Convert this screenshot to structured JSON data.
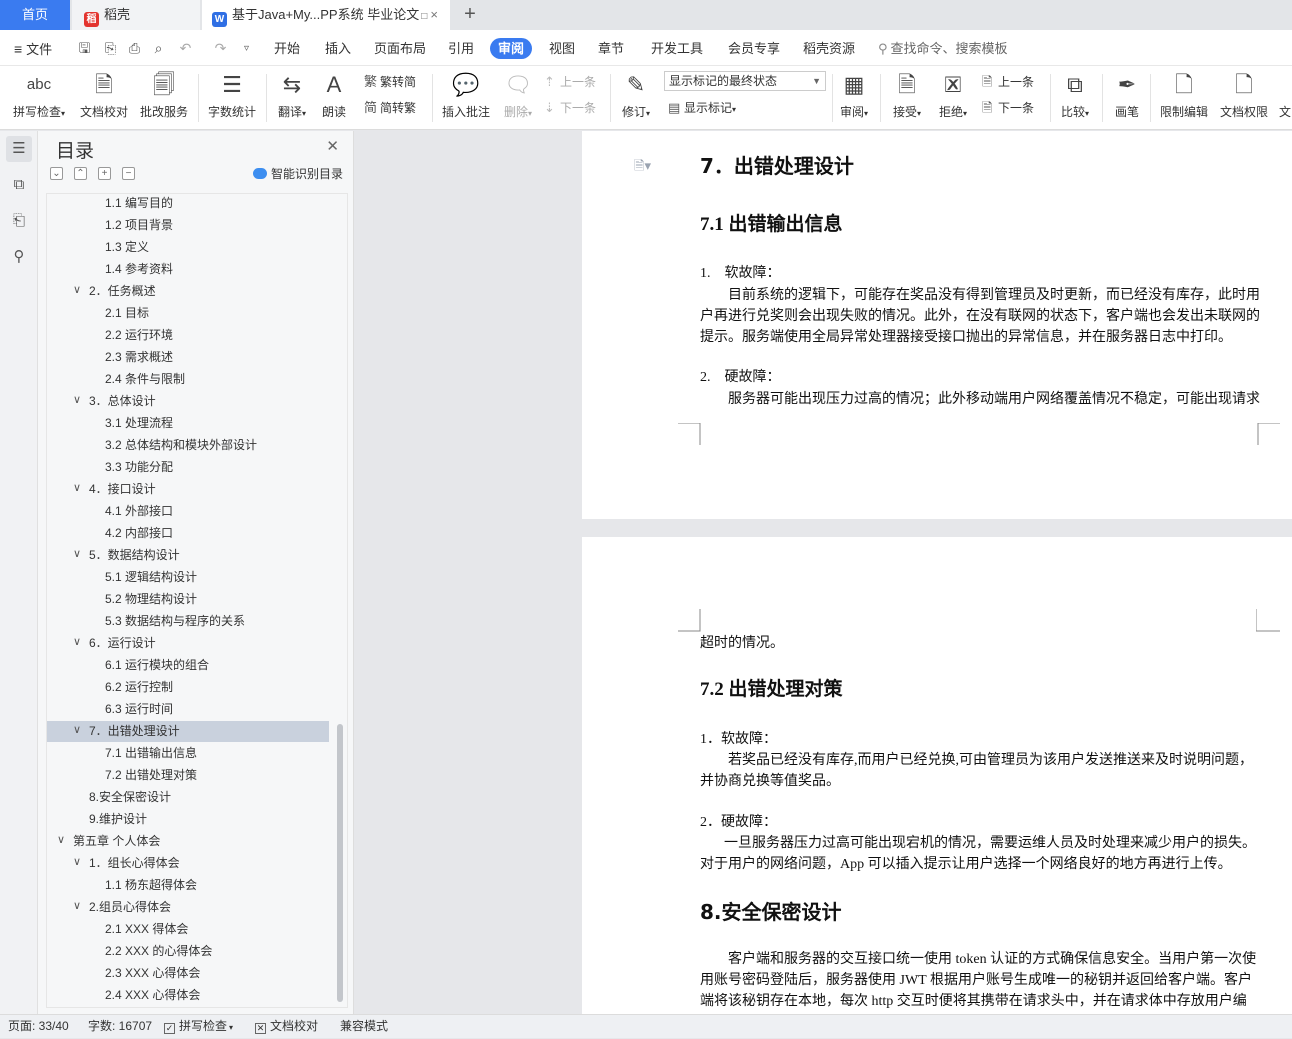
{
  "tabs": {
    "home": "首页",
    "daoke": "稻壳",
    "doc": "基于Java+My...PP系统 毕业论文",
    "doc_monitor_icon": "□",
    "close": "×",
    "add": "+"
  },
  "menu": {
    "file": "文件",
    "items": [
      "开始",
      "插入",
      "页面布局",
      "引用",
      "审阅",
      "视图",
      "章节",
      "开发工具",
      "会员专享",
      "稻壳资源"
    ],
    "active_index": 4,
    "search": "查找命令、搜索模板"
  },
  "ribbon": {
    "spell_check": "拼写检查",
    "doc_proof": "文档校对",
    "batch_service": "批改服务",
    "word_count": "字数统计",
    "translate": "翻译",
    "read_aloud": "朗读",
    "trad_simp": "繁转简",
    "simp_trad": "简转繁",
    "insert_comment": "插入批注",
    "delete": "删除",
    "prev": "上一条",
    "next": "下一条",
    "revise": "修订",
    "markup_state": "显示标记的最终状态",
    "show_markup": "显示标记",
    "review": "审阅",
    "accept": "接受",
    "reject": "拒绝",
    "prev2": "上一条",
    "next2": "下一条",
    "compare": "比较",
    "pen": "画笔",
    "restrict_edit": "限制编辑",
    "doc_permission": "文档权限",
    "cut_off": "文",
    "spell_icon_text": "abc"
  },
  "toc": {
    "title": "目录",
    "smart": "智能识别目录",
    "items": [
      {
        "text": "1.1 编写目的",
        "level": 3
      },
      {
        "text": "1.2 项目背景",
        "level": 3
      },
      {
        "text": "1.3 定义",
        "level": 3
      },
      {
        "text": "1.4 参考资料",
        "level": 3
      },
      {
        "text": "2．任务概述",
        "level": 2,
        "arrow": "∨"
      },
      {
        "text": "2.1 目标",
        "level": 3
      },
      {
        "text": "2.2 运行环境",
        "level": 3
      },
      {
        "text": "2.3 需求概述",
        "level": 3
      },
      {
        "text": "2.4 条件与限制",
        "level": 3
      },
      {
        "text": "3．总体设计",
        "level": 2,
        "arrow": "∨"
      },
      {
        "text": "3.1 处理流程",
        "level": 3
      },
      {
        "text": "3.2 总体结构和模块外部设计",
        "level": 3
      },
      {
        "text": "3.3 功能分配",
        "level": 3
      },
      {
        "text": "4．接口设计",
        "level": 2,
        "arrow": "∨"
      },
      {
        "text": "4.1 外部接口",
        "level": 3
      },
      {
        "text": "4.2 内部接口",
        "level": 3
      },
      {
        "text": "5．数据结构设计",
        "level": 2,
        "arrow": "∨"
      },
      {
        "text": "5.1 逻辑结构设计",
        "level": 3
      },
      {
        "text": "5.2 物理结构设计",
        "level": 3
      },
      {
        "text": "5.3 数据结构与程序的关系",
        "level": 3
      },
      {
        "text": "6．运行设计",
        "level": 2,
        "arrow": "∨"
      },
      {
        "text": "6.1 运行模块的组合",
        "level": 3
      },
      {
        "text": "6.2 运行控制",
        "level": 3
      },
      {
        "text": "6.3 运行时间",
        "level": 3
      },
      {
        "text": "7．出错处理设计",
        "level": 2,
        "arrow": "∨",
        "selected": true
      },
      {
        "text": "7.1 出错输出信息",
        "level": 3
      },
      {
        "text": "7.2 出错处理对策",
        "level": 3
      },
      {
        "text": "8.安全保密设计",
        "level": 2
      },
      {
        "text": "9.维护设计",
        "level": 2
      },
      {
        "text": "第五章  个人体会",
        "level": 1,
        "arrow": "∨"
      },
      {
        "text": "1．组长心得体会",
        "level": 2,
        "arrow": "∨"
      },
      {
        "text": "1.1  杨东超得体会",
        "level": 3
      },
      {
        "text": "2.组员心得体会",
        "level": 2,
        "arrow": "∨"
      },
      {
        "text": "2.1  XXX 得体会",
        "level": 3
      },
      {
        "text": "2.2  XXX 的心得体会",
        "level": 3
      },
      {
        "text": "2.3  XXX 心得体会",
        "level": 3
      },
      {
        "text": "2.4 XXX 心得体会",
        "level": 3
      }
    ]
  },
  "document": {
    "page1": {
      "h1": "7．出错处理设计",
      "h2": "7.1 出错输出信息",
      "list1_num": "1.",
      "list1_title": "软故障：",
      "para1": [
        "目前系统的逻辑下，可能存在奖品没有得到管理员及时更新，而已经没有库存，此时用",
        "户再进行兑奖则会出现失败的情况。此外，在没有联网的状态下，客户端也会发出未联网的",
        "提示。服务端使用全局异常处理器接受接口抛出的异常信息，并在服务器日志中打印。"
      ],
      "list2_num": "2.",
      "list2_title": "硬故障：",
      "para2": "服务器可能出现压力过高的情况；此外移动端用户网络覆盖情况不稳定，可能出现请求"
    },
    "page2": {
      "cont": "超时的情况。",
      "h2": "7.2 出错处理对策",
      "item1": "1．软故障：",
      "para1": [
        "若奖品已经没有库存,而用户已经兑换,可由管理员为该用户发送推送来及时说明问题，",
        "并协商兑换等值奖品。"
      ],
      "item2": "2．硬故障：",
      "para2": [
        "一旦服务器压力过高可能出现宕机的情况，需要运维人员及时处理来减少用户的损失。",
        "对于用户的网络问题，App 可以插入提示让用户选择一个网络良好的地方再进行上传。"
      ],
      "h1": "8.安全保密设计",
      "para3": [
        "客户端和服务器的交互接口统一使用 token 认证的方式确保信息安全。当用户第一次使",
        "用账号密码登陆后，服务器使用 JWT 根据用户账号生成唯一的秘钥并返回给客户端。客户",
        "端将该秘钥存在本地，每次 http 交互时便将其携带在请求头中，并在请求体中存放用户编"
      ]
    }
  },
  "status": {
    "page": "页面: 33/40",
    "words": "字数: 16707",
    "spell": "拼写检查",
    "proof": "文档校对",
    "compat": "兼容模式"
  },
  "colors": {
    "accent": "#3a7bf0",
    "toc_selected": "#c9d1dd"
  }
}
